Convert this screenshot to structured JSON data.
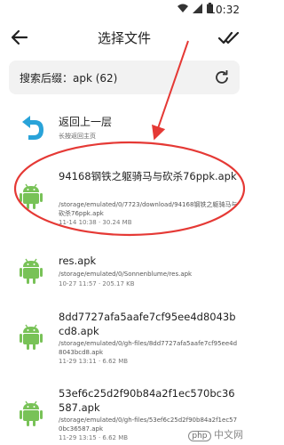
{
  "status_bar": {
    "time": "10:32",
    "icons": [
      "wifi-icon",
      "signal-icon",
      "battery-icon"
    ]
  },
  "app_bar": {
    "title": "选择文件",
    "back_icon": "arrow-left-icon",
    "confirm_icon": "double-check-icon"
  },
  "search": {
    "label": "搜索后缀：apk (62)",
    "refresh_icon": "refresh-icon"
  },
  "parent_entry": {
    "title": "返回上一层",
    "subtitle": "长按返回主页",
    "icon": "return-arrow-icon"
  },
  "files": [
    {
      "name": "94168钢铁之躯骑马与砍杀76ppk.apk",
      "path": "/storage/emulated/0/7723/download/94168钢铁之躯骑马与砍杀76ppk.apk",
      "meta": "11-14 10:38 · 30.24 MB",
      "highlighted": true
    },
    {
      "name": "res.apk",
      "path": "/storage/emulated/0/Sonnenblume/res.apk",
      "meta": "10-27 11:57 · 205.17 KB",
      "highlighted": false
    },
    {
      "name": "8dd7727afa5aafe7cf95ee4d8043bcd8.apk",
      "path": "/storage/emulated/0/gh-files/8dd7727afa5aafe7cf95ee4d8043bcd8.apk",
      "meta": "11-29 13:11 · 6.62 MB",
      "highlighted": false
    },
    {
      "name": "53ef6c25d2f90b84a2f1ec570bc36587.apk",
      "path": "/storage/emulated/0/gh-files/53ef6c25d2f90b84a2f1ec570bc36587.apk",
      "meta": "11-29 13:15 · 6.62 MB",
      "highlighted": false
    }
  ],
  "watermark": {
    "badge": "php",
    "text": "中文网"
  },
  "colors": {
    "android_green": "#78c257",
    "annotation_red": "#e53935",
    "return_blue": "#29a3d9"
  }
}
